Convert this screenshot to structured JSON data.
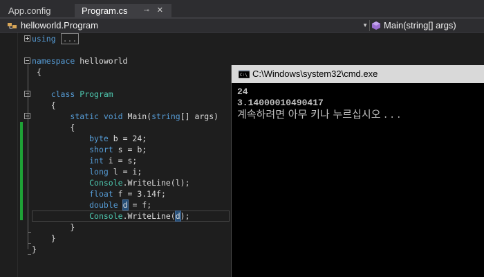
{
  "tabs": [
    {
      "label": "App.config"
    },
    {
      "label": "Program.cs",
      "pin": "⊸",
      "close": "✕"
    }
  ],
  "navbar": {
    "left": "helloworld.Program",
    "right": "Main(string[] args)"
  },
  "code": {
    "using_kw": "using",
    "using_collapsed": "...",
    "namespace_kw": "namespace",
    "namespace_name": " helloworld",
    "open_brace": "{",
    "close_brace": "}",
    "class_kw": "class",
    "class_name": "Program",
    "static_kw": "static",
    "void_kw": "void",
    "method_rest": " Main(",
    "string_kw": "string",
    "args_rest": "[] args)",
    "byte_kw": "byte",
    "byte_rest": " b = 24;",
    "short_kw": "short",
    "short_rest": " s = b;",
    "int_kw": "int",
    "int_rest": " i = s;",
    "long_kw": "long",
    "long_rest": " l = i;",
    "console_ty": "Console",
    "writeline1_rest": ".WriteLine(l);",
    "float_kw": "float",
    "float_rest": " f = 3.14f;",
    "double_kw": "double",
    "double_var": "d",
    "double_rest": " = f;",
    "writeline2_pre": ".WriteLine(",
    "writeline2_var": "d",
    "writeline2_post": ");"
  },
  "console": {
    "title": "C:\\Windows\\system32\\cmd.exe",
    "lines": [
      "24",
      "3.14000010490417",
      "계속하려면 아무 키나 누르십시오 . . ."
    ]
  }
}
